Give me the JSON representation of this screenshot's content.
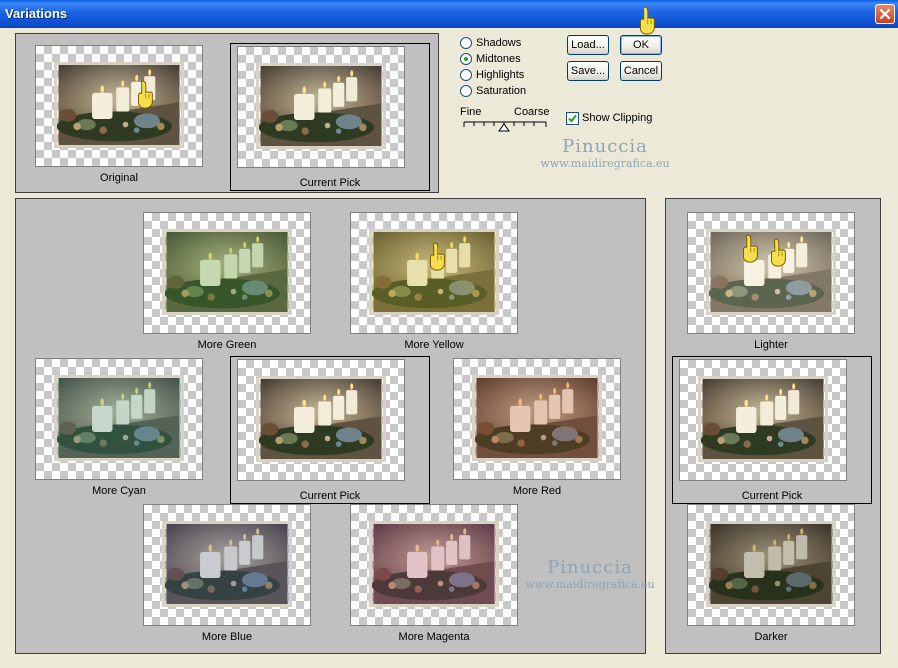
{
  "window": {
    "title": "Variations"
  },
  "colors": {
    "titlebar": "#0b53d9",
    "dialog": "#ece9d8",
    "panel": "#c0c0c0"
  },
  "icons": {
    "close": "close-icon",
    "pointer": "pointing-hand-icon",
    "check": "check-icon"
  },
  "top_preview": {
    "original_label": "Original",
    "current_label": "Current Pick"
  },
  "tone": {
    "options": [
      "Shadows",
      "Midtones",
      "Highlights",
      "Saturation"
    ],
    "selected": "Midtones"
  },
  "buttons": {
    "load": "Load...",
    "ok": "OK",
    "save": "Save...",
    "cancel": "Cancel"
  },
  "slider": {
    "fine_label": "Fine",
    "coarse_label": "Coarse"
  },
  "show_clipping": {
    "label": "Show Clipping",
    "checked": true
  },
  "color_variations": {
    "more_green": "More Green",
    "more_yellow": "More Yellow",
    "more_cyan": "More Cyan",
    "current_pick": "Current Pick",
    "more_red": "More Red",
    "more_blue": "More Blue",
    "more_magenta": "More Magenta"
  },
  "brightness": {
    "lighter": "Lighter",
    "current_pick": "Current Pick",
    "darker": "Darker"
  },
  "watermark": {
    "name": "Pinuccia",
    "url": "www.maidiregrafica.eu"
  }
}
